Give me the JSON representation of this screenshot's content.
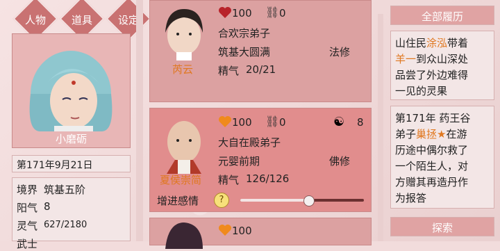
{
  "nav": {
    "char": "人物",
    "items": "道具",
    "settings": "设定"
  },
  "player": {
    "name": "小磨砺",
    "date": "第171年9月21日",
    "realm_label": "境界",
    "realm_value": "筑基五阶",
    "yang_label": "阳气",
    "yang_value": "8",
    "ling_label": "灵气",
    "ling_value": "627/2180",
    "cutoff_label": "武士"
  },
  "cards": [
    {
      "name": "芮云",
      "love": "100",
      "cuffs": "0",
      "sect": "合欢宗弟子",
      "realm": "筑基大圆满",
      "path": "法修",
      "essence_label": "精气",
      "essence": "20/21"
    },
    {
      "name": "夏侯崇简",
      "love": "100",
      "cuffs": "0",
      "yinyang": "8",
      "sect": "大自在殿弟子",
      "realm": "元婴前期",
      "path": "佛修",
      "essence_label": "精气",
      "essence": "126/126",
      "affection_label": "增进感情",
      "affection_level": 0.55
    },
    {
      "love": "100"
    }
  ],
  "history": {
    "title": "全部履历",
    "entry1": {
      "l1_a": "山住民",
      "l1_h": "涂泓",
      "l1_b": "带着",
      "l2_h": "羊一",
      "l2_b": "到众山深处",
      "l3": "品尝了外边难得",
      "l4": "一见的灵果"
    },
    "entry2": {
      "l1": "第171年 药王谷",
      "l2_a": "弟子",
      "l2_h": "巢拯★",
      "l2_b": "在游",
      "l3": "历途中偶尔救了",
      "l4": "一个陌生人，对",
      "l5": "方赠其再造丹作",
      "l6": "为报答"
    },
    "explore": "探索"
  },
  "colors": {
    "accent": "#c97272",
    "highlight": "#e07820"
  }
}
